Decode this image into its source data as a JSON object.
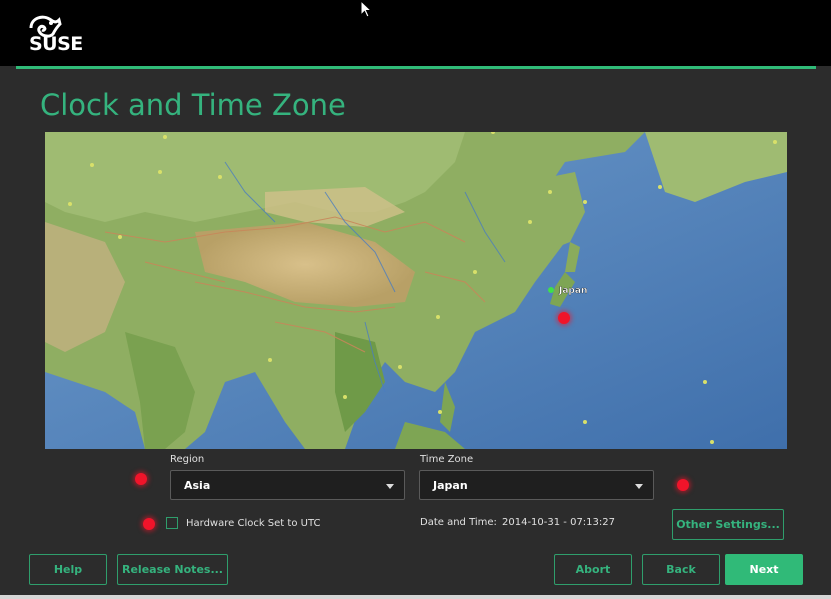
{
  "brand": {
    "name": "SUSE"
  },
  "page": {
    "title": "Clock and Time Zone"
  },
  "map": {
    "selected_marker_label": "Japan"
  },
  "region": {
    "label": "Region",
    "value": "Asia"
  },
  "timezone": {
    "label": "Time Zone",
    "value": "Japan"
  },
  "hardware_clock": {
    "label": "Hardware Clock Set to UTC",
    "checked": false
  },
  "datetime": {
    "label": "Date and Time:",
    "value": "2014-10-31 - 07:13:27"
  },
  "buttons": {
    "other_settings": "Other Settings...",
    "help": "Help",
    "release_notes": "Release Notes...",
    "abort": "Abort",
    "back": "Back",
    "next": "Next"
  },
  "colors": {
    "accent": "#30ba78",
    "title": "#35b37e",
    "background": "#2c2c2c",
    "highlight_dot": "#f0142a"
  }
}
